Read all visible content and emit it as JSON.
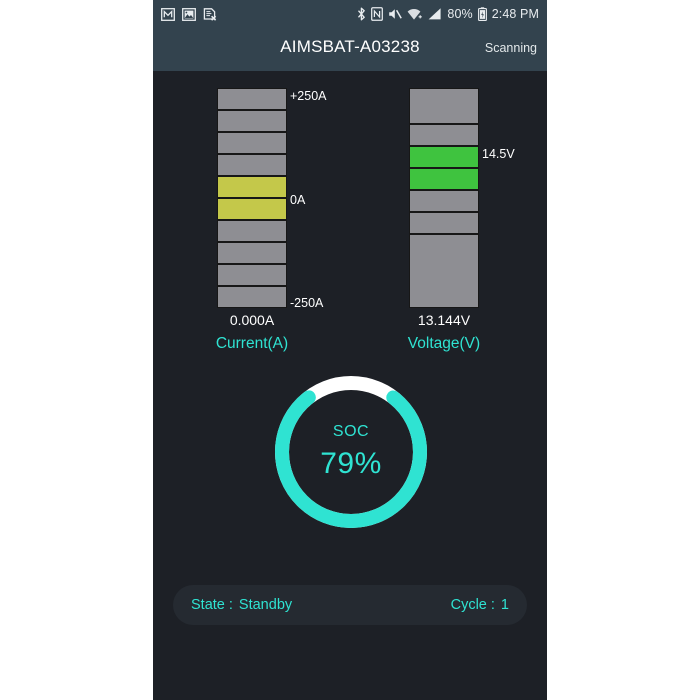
{
  "statusbar": {
    "left_icons": [
      {
        "name": "gmail-icon",
        "glyph": "M"
      },
      {
        "name": "gallery-image-icon",
        "glyph": "▣"
      },
      {
        "name": "document-removed-icon",
        "glyph": "⌧"
      }
    ],
    "right_icons": [
      {
        "name": "bluetooth-icon"
      },
      {
        "name": "nfc-icon"
      },
      {
        "name": "volume-muted-icon"
      },
      {
        "name": "wifi-icon"
      },
      {
        "name": "cellular-signal-icon"
      }
    ],
    "battery_percent": "80%",
    "battery_icon": "battery-icon",
    "clock": "2:48 PM"
  },
  "header": {
    "title": "AIMSBAT-A03238",
    "status": "Scanning"
  },
  "gauges": [
    {
      "id": "current",
      "name": "current-gauge",
      "label": "Current(A)",
      "value": "0.000A",
      "top_tick": "+250A",
      "mid_tick": "0A",
      "bottom_tick": "-250A",
      "segments": 10,
      "active_segments": [
        5,
        6
      ],
      "active_color": "#c4c84a",
      "inactive_color": "#8e8e93"
    },
    {
      "id": "voltage",
      "name": "voltage-gauge",
      "label": "Voltage(V)",
      "value": "13.144V",
      "marker_tick": "14.5V",
      "active_color": "#3fc33f",
      "inactive_color": "#8e8e93"
    }
  ],
  "soc": {
    "label": "SOC",
    "value": "79%",
    "percent": 79,
    "arc_color": "#2fe3d2",
    "track_color": "#ffffff"
  },
  "state_panel": {
    "state_key": "State :",
    "state_value": "Standby",
    "cycle_key": "Cycle :",
    "cycle_value": "1"
  },
  "colors": {
    "background": "#1d2026",
    "header": "#33434e",
    "accent": "#2fe3d2",
    "panel": "#252a31"
  },
  "chart_data": {
    "type": "bar",
    "title": "Battery monitor gauges",
    "charts": [
      {
        "name": "Current(A)",
        "unit": "A",
        "value": 0.0,
        "display_value": "0.000A",
        "axis_min": -250,
        "axis_max": 250,
        "axis_ticks": [
          "+250A",
          "0A",
          "-250A"
        ],
        "segment_count": 10,
        "filled_segments": [
          5,
          6
        ],
        "fill_color": "#c4c84a",
        "empty_color": "#8e8e93"
      },
      {
        "name": "Voltage(V)",
        "unit": "V",
        "value": 13.144,
        "display_value": "13.144V",
        "marker_label": "14.5V",
        "segment_count": 6,
        "filled_segments": [
          3,
          4
        ],
        "fill_color": "#3fc33f",
        "empty_color": "#8e8e93"
      },
      {
        "name": "SOC",
        "type": "donut",
        "value": 79,
        "display_value": "79%",
        "max": 100,
        "arc_color": "#2fe3d2",
        "track_color": "#ffffff"
      }
    ]
  }
}
